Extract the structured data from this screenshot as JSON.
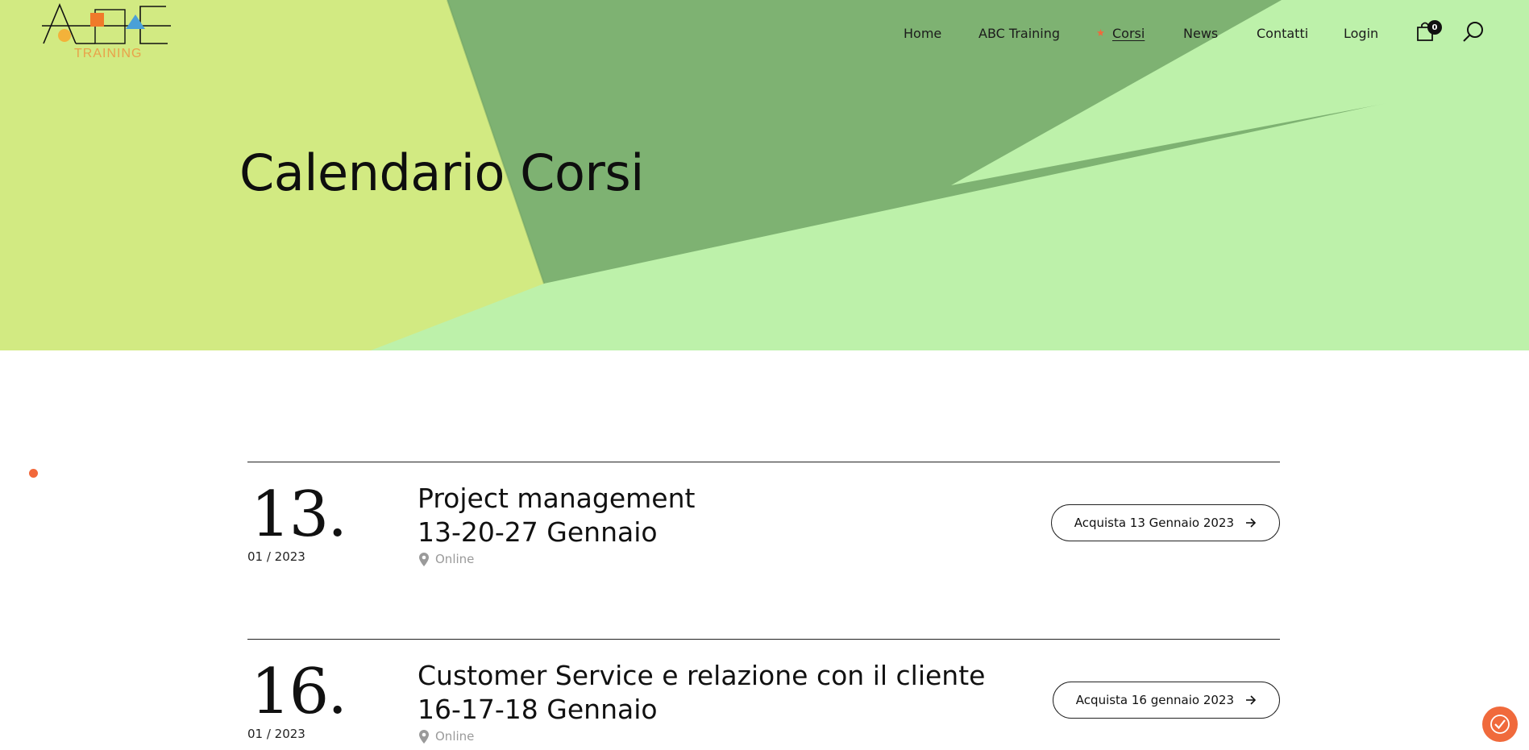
{
  "colors": {
    "hero_left": "#d2ea82",
    "hero_dark": "#7eb272",
    "hero_light": "#bdf1aa",
    "accent_orange": "#f2683b",
    "logo_orange": "#f07a2a",
    "logo_blue": "#4aa0d8",
    "logo_yellow": "#f3b23a"
  },
  "logo": {
    "subtitle": "TRAINING"
  },
  "nav": {
    "items": [
      {
        "label": "Home"
      },
      {
        "label": "ABC Training"
      },
      {
        "label": "Corsi",
        "active": true
      },
      {
        "label": "News"
      },
      {
        "label": "Contatti"
      },
      {
        "label": "Login"
      }
    ],
    "cart_count": "0"
  },
  "hero": {
    "title": "Calendario Corsi"
  },
  "events": [
    {
      "day": "13.",
      "monthyear": "01 / 2023",
      "title_line1": "Project management",
      "title_line2": "13-20-27 Gennaio",
      "location": "Online",
      "button": "Acquista 13 Gennaio 2023"
    },
    {
      "day": "16.",
      "monthyear": "01 / 2023",
      "title_line1": "Customer Service e relazione con il cliente",
      "title_line2": "16-17-18 Gennaio",
      "location": "Online",
      "button": "Acquista 16 gennaio 2023"
    }
  ]
}
